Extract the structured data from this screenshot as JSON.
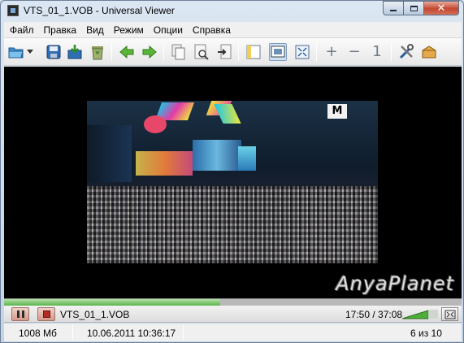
{
  "window": {
    "title": "VTS_01_1.VOB - Universal Viewer"
  },
  "menu": [
    "Файл",
    "Правка",
    "Вид",
    "Режим",
    "Опции",
    "Справка"
  ],
  "toolbar": {
    "icons": [
      "open-folder-icon",
      "dropdown-arrow-icon",
      "save-icon",
      "reload-icon",
      "recycle-bin-icon",
      "arrow-left-icon",
      "arrow-right-icon",
      "copy-icon",
      "print-preview-icon",
      "export-icon",
      "view-text-icon",
      "view-media-icon",
      "fit-window-icon",
      "zoom-in-icon",
      "zoom-out-icon",
      "original-size-icon",
      "settings-icon",
      "package-icon"
    ],
    "zoom_in_label": "+",
    "zoom_out_label": "−",
    "original_size_label": "1"
  },
  "video": {
    "channel_logo": "M",
    "watermark": "AnyaPlanet"
  },
  "player": {
    "progress": 0.4725,
    "filename": "VTS_01_1.VOB",
    "timecode": "17:50 / 37:08"
  },
  "status": {
    "size": "1008 Мб",
    "datetime": "10.06.2011 10:36:17",
    "position": "6 из 10"
  },
  "colors": {
    "progress_fill": "#5ab34a",
    "stop_red": "#b12d22",
    "close_button": "#c4472f"
  }
}
